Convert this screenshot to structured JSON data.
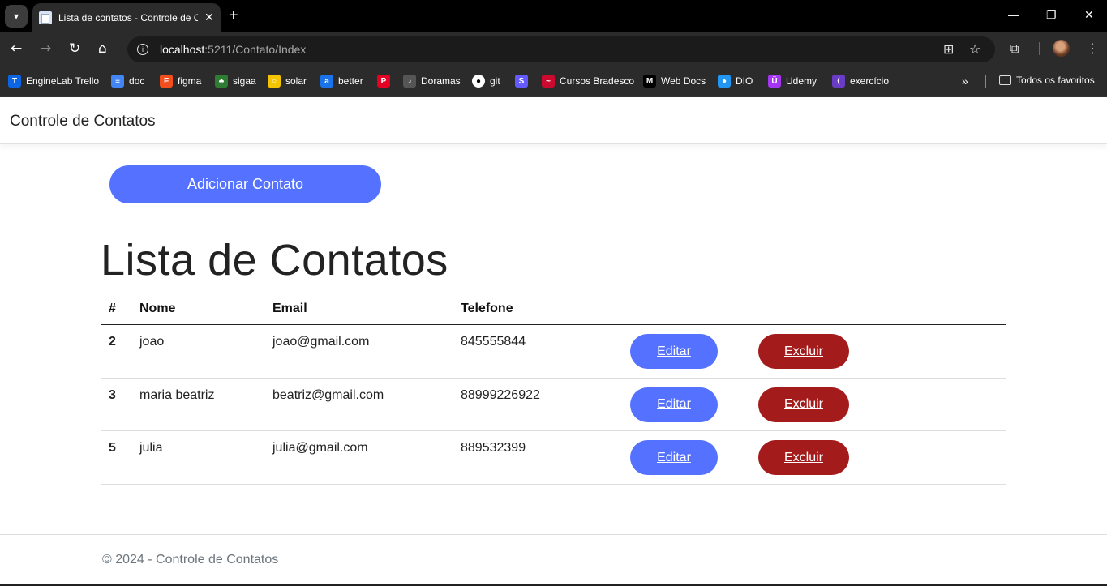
{
  "browser": {
    "tab_title": "Lista de contatos - Controle de Contatos",
    "url_host": "localhost",
    "url_rest": ":5211/Contato/Index",
    "bookmarks": [
      {
        "label": "EngineLab Trello",
        "icon": "trello-icon",
        "color": "#0c66e4"
      },
      {
        "label": "doc",
        "icon": "doc-icon",
        "color": "#4285f4"
      },
      {
        "label": "figma",
        "icon": "figma-icon",
        "color": "#f24e1e"
      },
      {
        "label": "sigaa",
        "icon": "sigaa-icon",
        "color": "#2e7d32"
      },
      {
        "label": "solar",
        "icon": "solar-icon",
        "color": "#f5c400"
      },
      {
        "label": "better",
        "icon": "better-icon",
        "color": "#1a73e8"
      },
      {
        "label": "",
        "icon": "pinterest-icon",
        "color": "#e60023"
      },
      {
        "label": "Doramas",
        "icon": "doramas-icon",
        "color": "#555555"
      },
      {
        "label": "git",
        "icon": "github-icon",
        "color": "#ffffff"
      },
      {
        "label": "",
        "icon": "s-icon",
        "color": "#635bff"
      },
      {
        "label": "Cursos Bradesco",
        "icon": "bradesco-icon",
        "color": "#cc092f"
      },
      {
        "label": "Web Docs",
        "icon": "mdn-icon",
        "color": "#000000"
      },
      {
        "label": "DIO",
        "icon": "dio-icon",
        "color": "#2196f3"
      },
      {
        "label": "Udemy",
        "icon": "udemy-icon",
        "color": "#a435f0"
      },
      {
        "label": "exercício",
        "icon": "exercicio-icon",
        "color": "#6a3cc6"
      }
    ],
    "all_bookmarks": "Todos os favoritos"
  },
  "site": {
    "brand": "Controle de Contatos",
    "add_button": "Adicionar Contato",
    "title": "Lista de Contatos",
    "footer": "© 2024 - Controle de Contatos"
  },
  "table": {
    "headers": [
      "#",
      "Nome",
      "Email",
      "Telefone"
    ],
    "rows": [
      {
        "id": "2",
        "nome": "joao",
        "email": "joao@gmail.com",
        "telefone": "845555844"
      },
      {
        "id": "3",
        "nome": "maria beatriz",
        "email": "beatriz@gmail.com",
        "telefone": "88999226922"
      },
      {
        "id": "5",
        "nome": "julia",
        "email": "julia@gmail.com",
        "telefone": "889532399"
      }
    ],
    "edit_label": "Editar",
    "delete_label": "Excluir"
  },
  "colors": {
    "primary": "#5472ff",
    "danger": "#a31b1b"
  }
}
